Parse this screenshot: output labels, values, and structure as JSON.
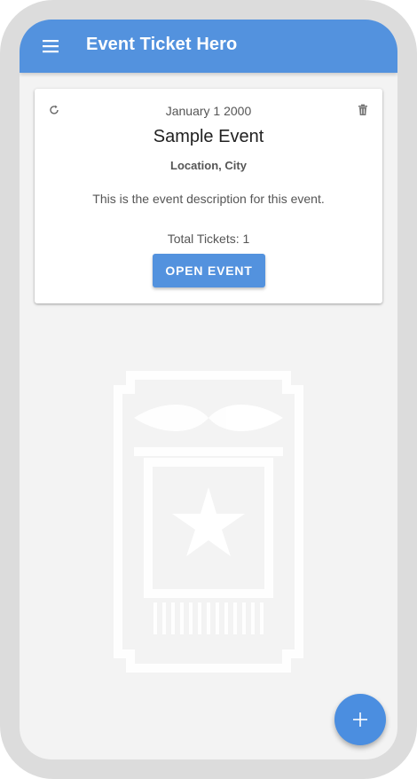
{
  "app": {
    "title": "Event Ticket Hero"
  },
  "icons": {
    "menu": "menu-icon",
    "refresh": "refresh-icon",
    "delete": "trash-icon",
    "add": "plus-icon",
    "background": "ticket-watermark-icon"
  },
  "colors": {
    "primary": "#5392de",
    "background": "#f3f3f3",
    "card": "#ffffff"
  },
  "event_card": {
    "date": "January 1 2000",
    "name": "Sample Event",
    "location": "Location, City",
    "description": "This is the event description for this event.",
    "tickets": "Total Tickets: 1",
    "open_label": "OPEN EVENT"
  }
}
